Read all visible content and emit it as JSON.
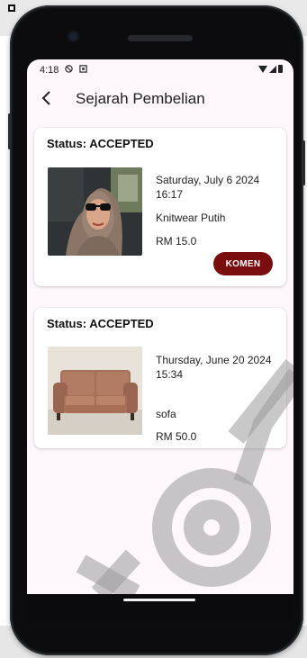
{
  "status_bar": {
    "time": "4:18",
    "icons": [
      "do-not-disturb-icon",
      "notification-icon",
      "wifi-icon",
      "signal-icon",
      "battery-icon"
    ]
  },
  "app_bar": {
    "title": "Sejarah Pembelian",
    "back_icon": "arrow-back-icon"
  },
  "orders": [
    {
      "status": "Status: ACCEPTED",
      "date": "Saturday, July 6 2024",
      "time": "16:17",
      "name": "Knitwear Putih",
      "price": "RM 15.0",
      "image": "photo of woman in hijab with sunglasses",
      "action_label": "KOMEN"
    },
    {
      "status": "Status: ACCEPTED",
      "date": "Thursday, June 20 2024",
      "time": "15:34",
      "name": "sofa",
      "price": "RM 50.0",
      "image": "photo of brown leather sofa"
    }
  ],
  "colors": {
    "screen_bg": "#fdf7fc",
    "accent_button": "#7a0d0d",
    "card_bg": "#ffffff"
  }
}
